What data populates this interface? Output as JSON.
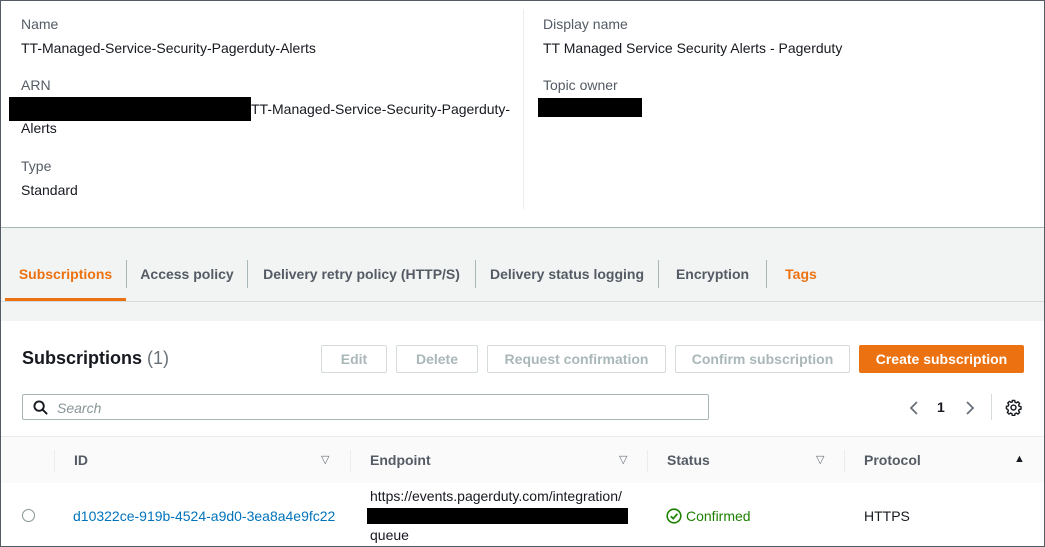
{
  "details": {
    "name_label": "Name",
    "name_value": "TT-Managed-Service-Security-Pagerduty-Alerts",
    "arn_label": "ARN",
    "arn_value_line1": "TT-Managed-Service-Security-Pagerduty-",
    "arn_value_line2": "Alerts",
    "type_label": "Type",
    "type_value": "Standard",
    "display_name_label": "Display name",
    "display_name_value": "TT Managed Service Security Alerts - Pagerduty",
    "topic_owner_label": "Topic owner"
  },
  "tabs": [
    {
      "label": "Subscriptions"
    },
    {
      "label": "Access policy"
    },
    {
      "label": "Delivery retry policy (HTTP/S)"
    },
    {
      "label": "Delivery status logging"
    },
    {
      "label": "Encryption"
    },
    {
      "label": "Tags"
    }
  ],
  "subscriptions": {
    "title": "Subscriptions",
    "count": "(1)",
    "buttons": {
      "edit": "Edit",
      "delete": "Delete",
      "request_confirmation": "Request confirmation",
      "confirm_subscription": "Confirm subscription",
      "create_subscription": "Create subscription"
    },
    "search_placeholder": "Search",
    "page": "1",
    "icons": {
      "search": "search-icon",
      "prev": "chevron-left-icon",
      "next": "chevron-right-icon",
      "settings": "gear-icon",
      "status": "check-circle-icon"
    },
    "colors": {
      "accent": "#ec7211",
      "link": "#0073bb",
      "success": "#1d8102"
    },
    "columns": {
      "id": "ID",
      "endpoint": "Endpoint",
      "status": "Status",
      "protocol": "Protocol"
    },
    "rows": [
      {
        "id": "d10322ce-919b-4524-a9d0-3ea8a4e9fc22",
        "endpoint_line1": "https://events.pagerduty.com/integration/",
        "endpoint_line3": "queue",
        "status": "Confirmed",
        "protocol": "HTTPS"
      }
    ]
  }
}
